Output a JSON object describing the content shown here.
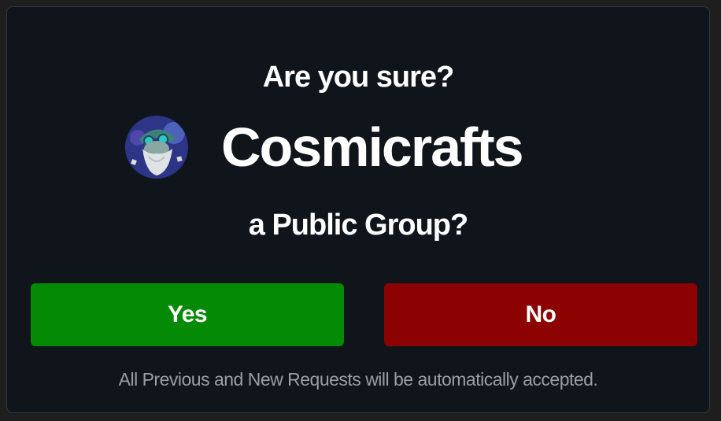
{
  "dialog": {
    "title": "Are you sure?",
    "group": {
      "name": "Cosmicrafts",
      "avatar_icon": "wizard-avatar-icon"
    },
    "subtitle": "a Public Group?",
    "buttons": {
      "yes_label": "Yes",
      "no_label": "No"
    },
    "note": "All Previous and New Requests will be automatically accepted."
  },
  "colors": {
    "background": "#10151c",
    "yes": "#058a05",
    "no": "#8c0101",
    "note_text": "#9a9ea4"
  }
}
